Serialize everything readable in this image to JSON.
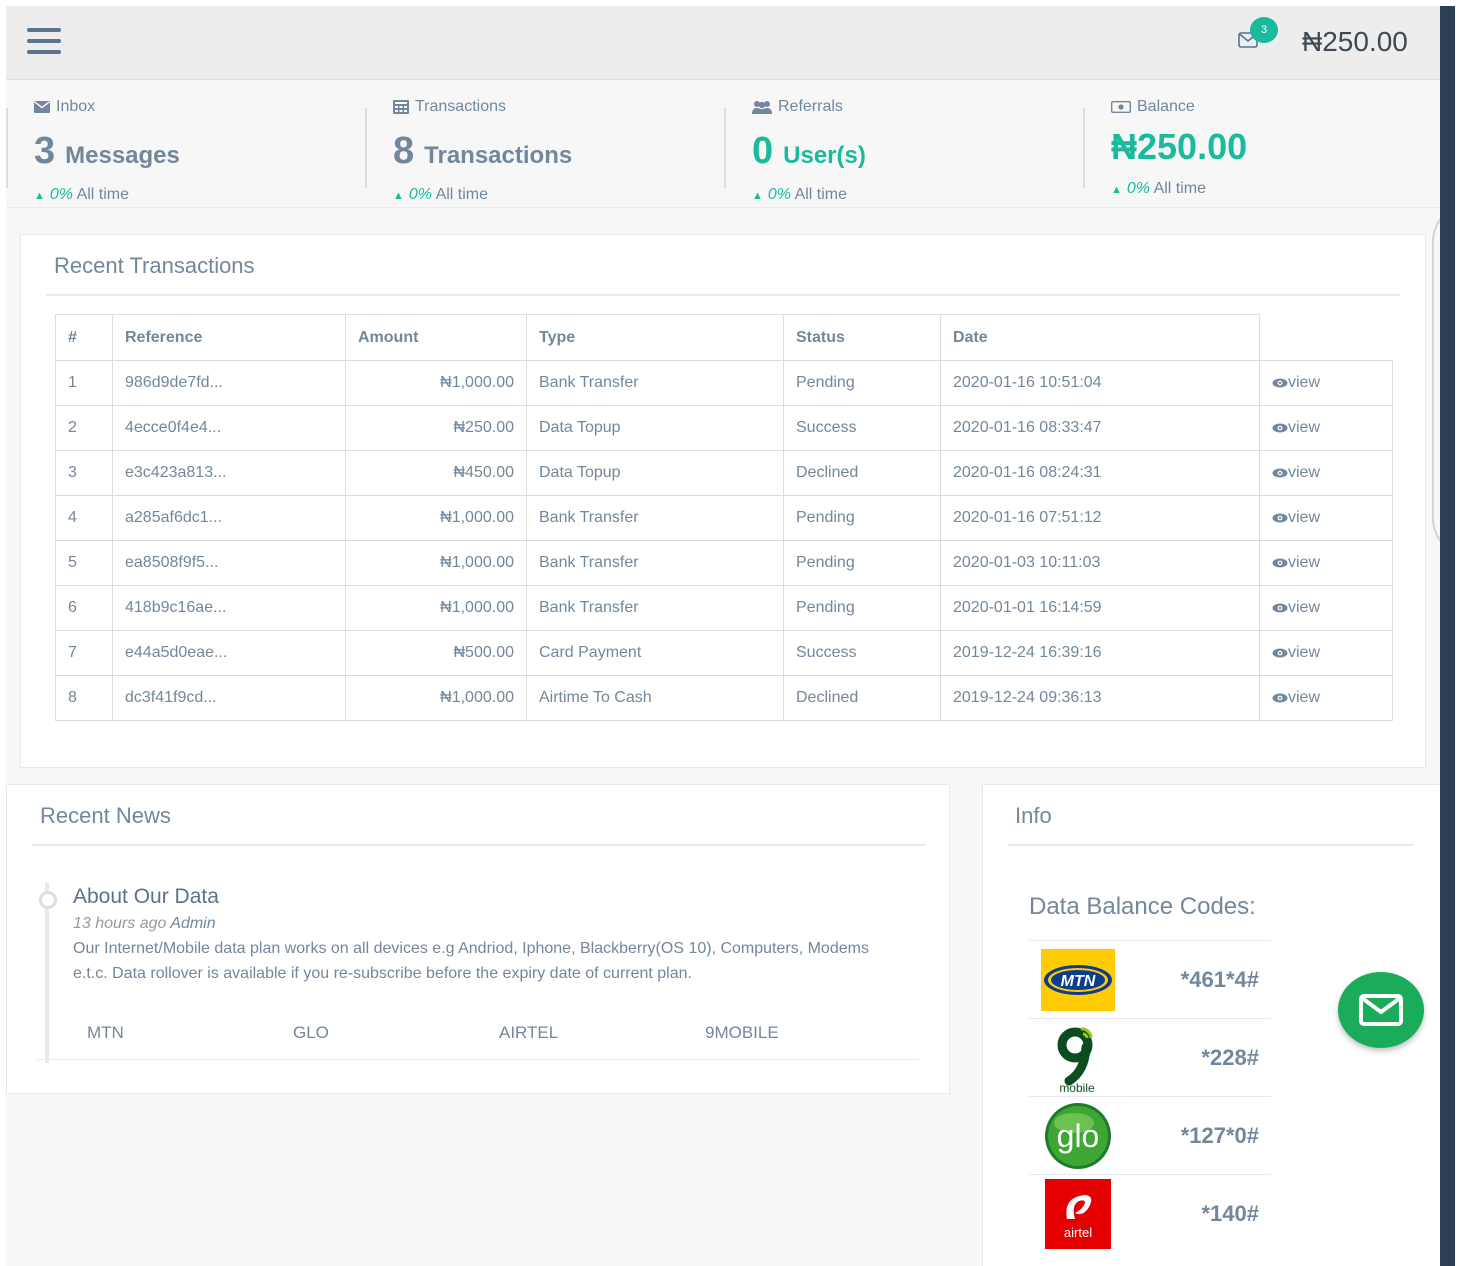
{
  "topbar": {
    "notification_count": "3",
    "balance": "₦250.00"
  },
  "stats": [
    {
      "title": "Inbox",
      "icon": "envelope-icon",
      "count": "3",
      "unit": "Messages",
      "percent": "0%",
      "period": "All time"
    },
    {
      "title": "Transactions",
      "icon": "calculator-icon",
      "count": "8",
      "unit": "Transactions",
      "percent": "0%",
      "period": "All time"
    },
    {
      "title": "Referrals",
      "icon": "users-icon",
      "count": "0",
      "unit": "User(s)",
      "percent": "0%",
      "period": "All time"
    },
    {
      "title": "Balance",
      "icon": "money-icon",
      "count": "₦250.00",
      "unit": "",
      "percent": "0%",
      "period": "All time"
    }
  ],
  "recent_transactions": {
    "title": "Recent Transactions",
    "columns": [
      "#",
      "Reference",
      "Amount",
      "Type",
      "Status",
      "Date"
    ],
    "view_label": "view",
    "rows": [
      {
        "n": "1",
        "ref": "986d9de7fd...",
        "amount": "₦1,000.00",
        "type": "Bank Transfer",
        "status": "Pending",
        "date": "2020-01-16 10:51:04"
      },
      {
        "n": "2",
        "ref": "4ecce0f4e4...",
        "amount": "₦250.00",
        "type": "Data Topup",
        "status": "Success",
        "date": "2020-01-16 08:33:47"
      },
      {
        "n": "3",
        "ref": "e3c423a813...",
        "amount": "₦450.00",
        "type": "Data Topup",
        "status": "Declined",
        "date": "2020-01-16 08:24:31"
      },
      {
        "n": "4",
        "ref": "a285af6dc1...",
        "amount": "₦1,000.00",
        "type": "Bank Transfer",
        "status": "Pending",
        "date": "2020-01-16 07:51:12"
      },
      {
        "n": "5",
        "ref": "ea8508f9f5...",
        "amount": "₦1,000.00",
        "type": "Bank Transfer",
        "status": "Pending",
        "date": "2020-01-03 10:11:03"
      },
      {
        "n": "6",
        "ref": "418b9c16ae...",
        "amount": "₦1,000.00",
        "type": "Bank Transfer",
        "status": "Pending",
        "date": "2020-01-01 16:14:59"
      },
      {
        "n": "7",
        "ref": "e44a5d0eae...",
        "amount": "₦500.00",
        "type": "Card Payment",
        "status": "Success",
        "date": "2019-12-24 16:39:16"
      },
      {
        "n": "8",
        "ref": "dc3f41f9cd...",
        "amount": "₦1,000.00",
        "type": "Airtime To Cash",
        "status": "Declined",
        "date": "2019-12-24 09:36:13"
      }
    ]
  },
  "recent_news": {
    "title": "Recent News",
    "item": {
      "title": "About Our Data",
      "time": "13 hours ago",
      "author": "Admin",
      "body": "Our Internet/Mobile data plan works on all devices e.g Andriod, Iphone, Blackberry(OS 10), Computers, Modems e.t.c. Data rollover is available if you re-subscribe before the expiry date of current plan."
    },
    "tabs": [
      "MTN",
      "GLO",
      "AIRTEL",
      "9MOBILE"
    ]
  },
  "info": {
    "title": "Info",
    "codes_title": "Data Balance Codes:",
    "codes": [
      {
        "network": "mtn-logo",
        "logo_text": "MTN",
        "code": "*461*4#"
      },
      {
        "network": "9mobile-logo",
        "logo_text": "mobile",
        "code": "*228#"
      },
      {
        "network": "glo-logo",
        "logo_text": "glo",
        "code": "*127*0#"
      },
      {
        "network": "airtel-logo",
        "logo_text": "airtel",
        "code": "*140#"
      }
    ]
  },
  "colors": {
    "accent": "#1abb9c",
    "text": "#73879c",
    "sidebar": "#2a3f54",
    "fab": "#1aac5b"
  }
}
